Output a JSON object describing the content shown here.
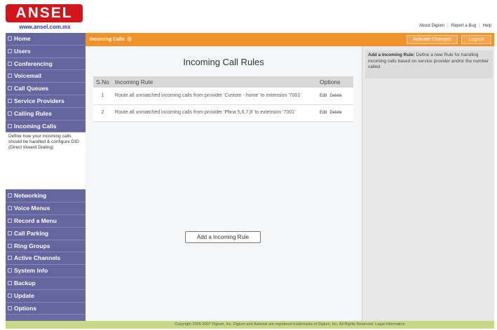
{
  "logo": {
    "brand": "ANSEL",
    "url": "www.ansel.com.mx"
  },
  "toplinks": [
    "About Digium",
    "Report a Bug",
    "Help"
  ],
  "sidebar": {
    "items_top": [
      "Home",
      "Users",
      "Conferencing",
      "Voicemail",
      "Call Queues",
      "Service Providers",
      "Calling Rules",
      "Incoming Calls"
    ],
    "active_description": "Define how your incoming calls should be handled & configure DID (Direct Inward Dialing)",
    "items_bottom": [
      "Networking",
      "Voice Menus",
      "Record a Menu",
      "Call Parking",
      "Ring Groups",
      "Active Channels",
      "System Info",
      "Backup",
      "Update",
      "Options"
    ]
  },
  "topbar": {
    "title": "Incoming Calls",
    "activate_label": "Activate Changes",
    "logout_label": "Logout"
  },
  "main": {
    "title": "Incoming Call Rules",
    "table": {
      "headers": [
        "S.No",
        "Incoming Rule",
        "Options"
      ],
      "rows": [
        {
          "sno": "1",
          "rule": "Route all unmatched incoming calls from provider 'Custom - home' to extension '7001'",
          "edit": "Edit",
          "delete": "Delete"
        },
        {
          "sno": "2",
          "rule": "Route all unmatched incoming calls from provider 'Pbna 5,6,7,8' to extension '7001'",
          "edit": "Edit",
          "delete": "Delete"
        }
      ]
    },
    "add_button": "Add a Incoming Rule"
  },
  "help": {
    "heading": "Add a Incoming Rule:",
    "text": "Define a new Rule for handling incoming calls based on service provider and/or the number called."
  },
  "footer": {
    "text": "Copyright 2006-2007 Digium, Inc. Digium and Asterisk are registered trademarks of Digium, Inc. All Rights Reserved. Legal Information"
  },
  "colors": {
    "sidebar": "#6565a0",
    "topbar": "#f0912a",
    "logo": "#d2141b",
    "footer": "#c8d986"
  }
}
